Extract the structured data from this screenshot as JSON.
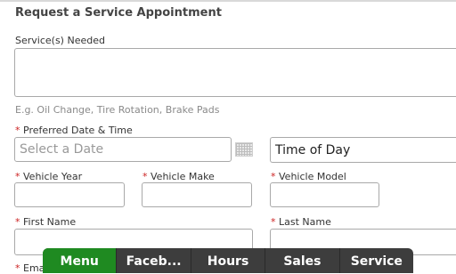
{
  "form": {
    "title": "Request a Service Appointment",
    "services": {
      "label": "Service(s) Needed",
      "hint": "E.g. Oil Change, Tire Rotation, Brake Pads"
    },
    "date": {
      "required_mark": "*",
      "label": "Preferred Date & Time",
      "placeholder": "Select a Date",
      "calendar_icon": "calendar-icon",
      "time_value": "Time of Day"
    },
    "vehicle_year": {
      "required_mark": "*",
      "label": "Vehicle Year"
    },
    "vehicle_make": {
      "required_mark": "*",
      "label": "Vehicle Make"
    },
    "vehicle_model": {
      "required_mark": "*",
      "label": "Vehicle Model"
    },
    "first_name": {
      "required_mark": "*",
      "label": "First Name"
    },
    "last_name": {
      "required_mark": "*",
      "label": "Last Name"
    },
    "email": {
      "required_mark": "*",
      "label": "Ema"
    }
  },
  "tabbar": {
    "active_color": "#1f8a21",
    "tabs": [
      {
        "label": "Menu"
      },
      {
        "label": "Faceb..."
      },
      {
        "label": "Hours"
      },
      {
        "label": "Sales"
      },
      {
        "label": "Service"
      }
    ]
  }
}
